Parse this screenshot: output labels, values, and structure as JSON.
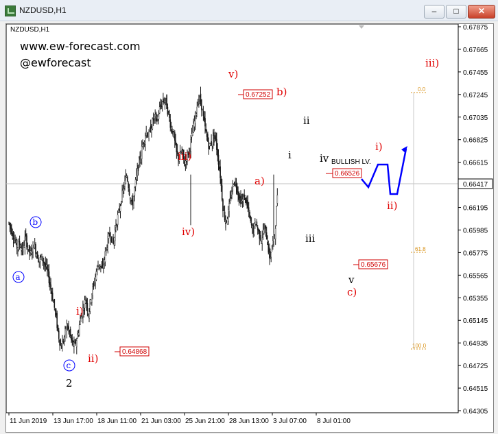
{
  "window": {
    "title": "NZDUSD,H1",
    "controls": {
      "minimize": "–",
      "maximize": "□",
      "close": "✕"
    },
    "icon": "chart-window-icon"
  },
  "chart_data": {
    "type": "candlestick",
    "symbol_label": "NZDUSD,H1",
    "branding": {
      "site": "www.ew-forecast.com",
      "handle": "@ewforecast"
    },
    "y_ticks": [
      "0.67875",
      "0.67665",
      "0.67455",
      "0.67245",
      "0.67035",
      "0.66825",
      "0.66615",
      "0.66405",
      "0.66195",
      "0.65985",
      "0.65775",
      "0.65565",
      "0.65355",
      "0.65145",
      "0.64935",
      "0.64725",
      "0.64515",
      "0.64305"
    ],
    "ylim": [
      0.64305,
      0.67875
    ],
    "x_ticks": [
      "11 Jun 2019",
      "13 Jun 17:00",
      "18 Jun 11:00",
      "21 Jun 03:00",
      "25 Jun 21:00",
      "28 Jun 13:00",
      "3 Jul 07:00",
      "8 Jul 01:00"
    ],
    "current_price": "0.66417",
    "price_labels": [
      "0.67252",
      "0.66526",
      "0.65676",
      "0.64868"
    ],
    "price_path": [
      [
        0,
        0.6605
      ],
      [
        4,
        0.6598
      ],
      [
        8,
        0.659
      ],
      [
        12,
        0.6582
      ],
      [
        16,
        0.6586
      ],
      [
        20,
        0.6579
      ],
      [
        24,
        0.6592
      ],
      [
        28,
        0.6581
      ],
      [
        32,
        0.6575
      ],
      [
        36,
        0.6586
      ],
      [
        40,
        0.6578
      ],
      [
        44,
        0.657
      ],
      [
        48,
        0.6573
      ],
      [
        52,
        0.6567
      ],
      [
        56,
        0.656
      ],
      [
        60,
        0.6548
      ],
      [
        64,
        0.6535
      ],
      [
        68,
        0.652
      ],
      [
        72,
        0.6502
      ],
      [
        76,
        0.6489
      ],
      [
        80,
        0.6497
      ],
      [
        84,
        0.651
      ],
      [
        88,
        0.6504
      ],
      [
        92,
        0.6493
      ],
      [
        96,
        0.649
      ],
      [
        100,
        0.65
      ],
      [
        104,
        0.6515
      ],
      [
        108,
        0.6525
      ],
      [
        112,
        0.6535
      ],
      [
        116,
        0.652
      ],
      [
        120,
        0.6538
      ],
      [
        124,
        0.6548
      ],
      [
        128,
        0.6562
      ],
      [
        132,
        0.6568
      ],
      [
        136,
        0.656
      ],
      [
        140,
        0.6575
      ],
      [
        144,
        0.6588
      ],
      [
        148,
        0.6596
      ],
      [
        152,
        0.6585
      ],
      [
        156,
        0.6604
      ],
      [
        160,
        0.6614
      ],
      [
        164,
        0.6628
      ],
      [
        168,
        0.664
      ],
      [
        172,
        0.665
      ],
      [
        176,
        0.6632
      ],
      [
        180,
        0.662
      ],
      [
        184,
        0.664
      ],
      [
        188,
        0.6656
      ],
      [
        192,
        0.6668
      ],
      [
        196,
        0.6681
      ],
      [
        200,
        0.669
      ],
      [
        204,
        0.6686
      ],
      [
        208,
        0.6696
      ],
      [
        212,
        0.6704
      ],
      [
        216,
        0.67
      ],
      [
        220,
        0.6712
      ],
      [
        224,
        0.6718
      ],
      [
        228,
        0.672
      ],
      [
        232,
        0.6708
      ],
      [
        236,
        0.6695
      ],
      [
        240,
        0.6688
      ],
      [
        244,
        0.667
      ],
      [
        248,
        0.6665
      ],
      [
        252,
        0.6672
      ],
      [
        256,
        0.666
      ],
      [
        260,
        0.6668
      ],
      [
        264,
        0.6676
      ],
      [
        268,
        0.669
      ],
      [
        272,
        0.6705
      ],
      [
        276,
        0.6721
      ],
      [
        280,
        0.6718
      ],
      [
        284,
        0.67
      ],
      [
        288,
        0.6686
      ],
      [
        292,
        0.6676
      ],
      [
        296,
        0.6681
      ],
      [
        300,
        0.6688
      ],
      [
        304,
        0.667
      ],
      [
        308,
        0.665
      ],
      [
        312,
        0.662
      ],
      [
        316,
        0.6605
      ],
      [
        320,
        0.6615
      ],
      [
        324,
        0.6632
      ],
      [
        328,
        0.6645
      ],
      [
        332,
        0.664
      ],
      [
        336,
        0.6628
      ],
      [
        340,
        0.6625
      ],
      [
        344,
        0.663
      ],
      [
        348,
        0.662
      ],
      [
        352,
        0.6605
      ],
      [
        356,
        0.6598
      ],
      [
        360,
        0.6606
      ],
      [
        364,
        0.6596
      ],
      [
        368,
        0.659
      ],
      [
        372,
        0.66
      ],
      [
        376,
        0.6592
      ],
      [
        380,
        0.6572
      ],
      [
        384,
        0.6585
      ],
      [
        388,
        0.6596
      ],
      [
        392,
        0.664
      ]
    ],
    "wave_labels": {
      "circled": [
        "a",
        "b",
        "c"
      ],
      "black": [
        "2",
        "i",
        "ii",
        "iii",
        "iv",
        "v"
      ],
      "red": [
        "v)",
        "b)",
        "a)",
        "iii)",
        "iv)",
        "i)",
        "ii)",
        "c)",
        "i)",
        "ii)",
        "iii)"
      ]
    },
    "projection_label": "BULLISH LV.",
    "fib_levels": [
      "0.0",
      "61.8",
      "100.0"
    ]
  },
  "colors": {
    "wave_red": "#e00000",
    "projection_blue": "#0000ff",
    "fib_orange": "#d9931a",
    "candles": "#1a1a1a"
  }
}
